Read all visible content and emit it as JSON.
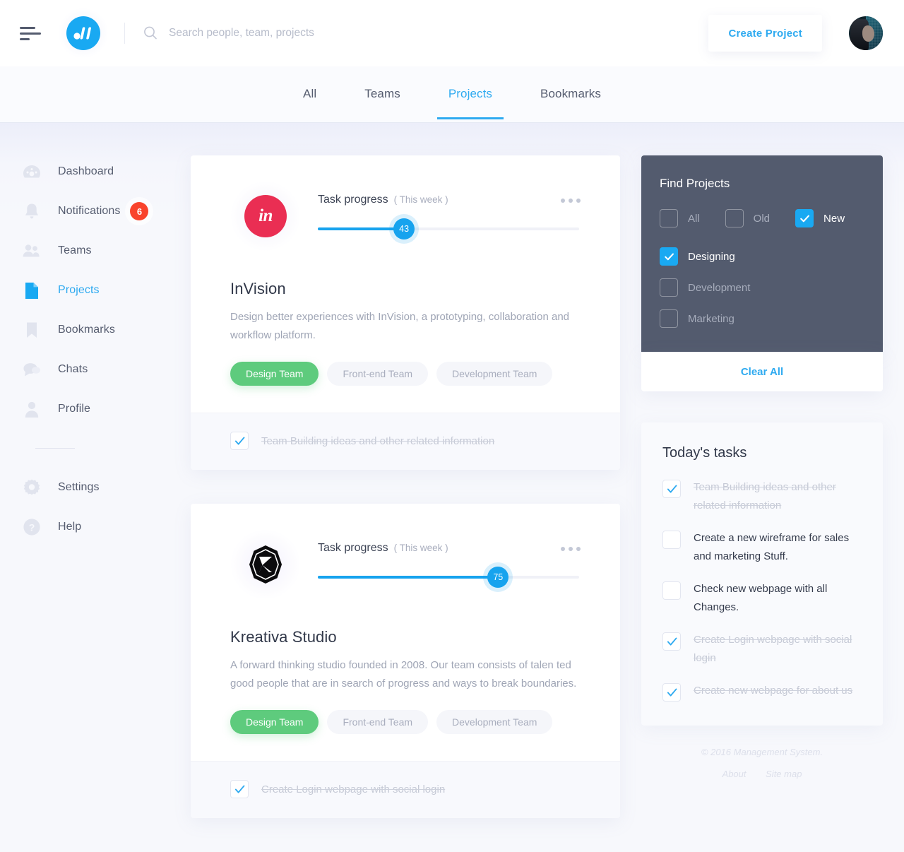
{
  "header": {
    "menu_icon": "hamburger-icon",
    "logo_icon": "app-logo-icon",
    "search": {
      "value": "",
      "placeholder": "Search people, team, projects",
      "icon": "search-icon"
    },
    "create_button": "Create Project",
    "avatar_icon": "user-avatar"
  },
  "tabs": [
    {
      "label": "All",
      "active": false
    },
    {
      "label": "Teams",
      "active": false
    },
    {
      "label": "Projects",
      "active": true
    },
    {
      "label": "Bookmarks",
      "active": false
    }
  ],
  "sidebar": {
    "items": [
      {
        "label": "Dashboard",
        "icon": "dashboard-icon",
        "active": false,
        "badge": ""
      },
      {
        "label": "Notifications",
        "icon": "bell-icon",
        "active": false,
        "badge": "6"
      },
      {
        "label": "Teams",
        "icon": "people-icon",
        "active": false,
        "badge": ""
      },
      {
        "label": "Projects",
        "icon": "file-icon",
        "active": true,
        "badge": ""
      },
      {
        "label": "Bookmarks",
        "icon": "bookmark-icon",
        "active": false,
        "badge": ""
      },
      {
        "label": "Chats",
        "icon": "chat-icon",
        "active": false,
        "badge": ""
      },
      {
        "label": "Profile",
        "icon": "person-icon",
        "active": false,
        "badge": ""
      }
    ],
    "bottom_items": [
      {
        "label": "Settings",
        "icon": "gear-icon",
        "active": false
      },
      {
        "label": "Help",
        "icon": "question-icon",
        "active": false
      }
    ]
  },
  "cards": [
    {
      "progress_title": "Task progress",
      "progress_period": "( This week )",
      "progress_value": "43",
      "progress_percent": 33,
      "name": "InVision",
      "description": "Design better experiences with InVision, a prototyping, collaboration and workflow platform.",
      "logo_text": "in",
      "logo_icon": "invision-logo-icon",
      "menu_icon": "more-options-icon",
      "chips": [
        {
          "label": "Design Team",
          "selected": true
        },
        {
          "label": "Front-end Team",
          "selected": false
        },
        {
          "label": "Development Team",
          "selected": false
        }
      ],
      "footer_task": {
        "label": "Team Building ideas and other related information",
        "checked": true
      }
    },
    {
      "progress_title": "Task progress",
      "progress_period": "( This week )",
      "progress_value": "75",
      "progress_percent": 69,
      "name": "Kreativa Studio",
      "description": "A forward thinking studio founded in 2008. Our team consists of talen ted good people that are in search of progress and ways to break boundaries.",
      "logo_text": "",
      "logo_icon": "kreativa-logo-icon",
      "menu_icon": "more-options-icon",
      "chips": [
        {
          "label": "Design Team",
          "selected": true
        },
        {
          "label": "Front-end Team",
          "selected": false
        },
        {
          "label": "Development Team",
          "selected": false
        }
      ],
      "footer_task": {
        "label": "Create Login webpage  with social login",
        "checked": true
      }
    }
  ],
  "find_projects": {
    "title": "Find Projects",
    "age_filters": [
      {
        "label": "All",
        "checked": false
      },
      {
        "label": "Old",
        "checked": false
      },
      {
        "label": "New",
        "checked": true
      }
    ],
    "category_filters": [
      {
        "label": "Designing",
        "checked": true
      },
      {
        "label": "Development",
        "checked": false
      },
      {
        "label": "Marketing",
        "checked": false
      }
    ],
    "clear_label": "Clear All"
  },
  "todays_tasks": {
    "title": "Today's tasks",
    "items": [
      {
        "label": "Team Building ideas and other related information",
        "checked": true
      },
      {
        "label": "Create a new wireframe for sales and marketing Stuff.",
        "checked": false
      },
      {
        "label": "Check new webpage with all Changes.",
        "checked": false
      },
      {
        "label": "Create Login webpage  with social login",
        "checked": true
      },
      {
        "label": "Create new webpage for about us",
        "checked": true
      }
    ]
  },
  "footer": {
    "copyright": "© 2016 Management System.",
    "links": [
      "About",
      "Site map"
    ]
  },
  "colors": {
    "accent": "#2eaaf0",
    "progress": "#17a3ee",
    "chip_on": "#5ecb7d",
    "badge": "#f9432c",
    "panel_dark": "#535b6e",
    "invision": "#ea2e53"
  }
}
